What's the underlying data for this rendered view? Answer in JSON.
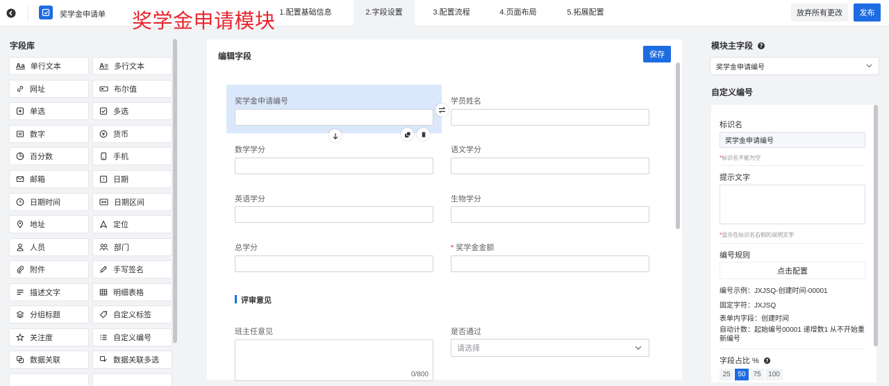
{
  "header": {
    "app_name": "奖学金申请单",
    "overlay_title": "奖学金申请模块",
    "steps": [
      {
        "label": "1.配置基础信息"
      },
      {
        "label": "2.字段设置"
      },
      {
        "label": "3.配置流程"
      },
      {
        "label": "4.页面布局"
      },
      {
        "label": "5.拓展配置"
      }
    ],
    "discard_label": "放弃所有更改",
    "publish_label": "发布"
  },
  "library": {
    "title": "字段库",
    "items": [
      {
        "label": "单行文本",
        "icon": "text-icon"
      },
      {
        "label": "多行文本",
        "icon": "multiline-text-icon"
      },
      {
        "label": "网址",
        "icon": "link-icon"
      },
      {
        "label": "布尔值",
        "icon": "boolean-icon"
      },
      {
        "label": "单选",
        "icon": "radio-icon"
      },
      {
        "label": "多选",
        "icon": "checkbox-icon"
      },
      {
        "label": "数字",
        "icon": "number-icon"
      },
      {
        "label": "货币",
        "icon": "currency-icon"
      },
      {
        "label": "百分数",
        "icon": "percent-icon"
      },
      {
        "label": "手机",
        "icon": "phone-icon"
      },
      {
        "label": "邮箱",
        "icon": "mail-icon"
      },
      {
        "label": "日期",
        "icon": "date-icon"
      },
      {
        "label": "日期时间",
        "icon": "clock-icon"
      },
      {
        "label": "日期区间",
        "icon": "date-range-icon"
      },
      {
        "label": "地址",
        "icon": "location-icon"
      },
      {
        "label": "定位",
        "icon": "navigation-icon"
      },
      {
        "label": "人员",
        "icon": "person-icon"
      },
      {
        "label": "部门",
        "icon": "department-icon"
      },
      {
        "label": "附件",
        "icon": "paperclip-icon"
      },
      {
        "label": "手写签名",
        "icon": "pen-icon"
      },
      {
        "label": "描述文字",
        "icon": "description-icon"
      },
      {
        "label": "明细表格",
        "icon": "table-icon"
      },
      {
        "label": "分组标题",
        "icon": "layers-icon"
      },
      {
        "label": "自定义标签",
        "icon": "tag-icon"
      },
      {
        "label": "关注度",
        "icon": "star-icon"
      },
      {
        "label": "自定义编号",
        "icon": "list-number-icon"
      },
      {
        "label": "数据关联",
        "icon": "data-link-icon"
      },
      {
        "label": "数据关联多选",
        "icon": "data-link-multi-icon"
      }
    ]
  },
  "editor": {
    "title": "编辑字段",
    "save_label": "保存",
    "fields": {
      "f1": {
        "label": "奖学金申请编号"
      },
      "f2": {
        "label": "学员姓名"
      },
      "f3": {
        "label": "数学学分"
      },
      "f4": {
        "label": "语文学分"
      },
      "f5": {
        "label": "英语学分"
      },
      "f6": {
        "label": "生物学分"
      },
      "f7": {
        "label": "总学分"
      },
      "f8": {
        "label": "奖学金金额",
        "required_mark": "*"
      }
    },
    "section_title": "评审意见",
    "comment_label": "班主任意见",
    "comment_counter": "0/800",
    "pass_label": "是否通过",
    "pass_placeholder": "请选择"
  },
  "right": {
    "main_field_title": "模块主字段",
    "main_field_value": "奖学金申请编号",
    "custom_number_title": "自定义编号",
    "id_name_label": "标识名",
    "id_name_value": "奖学金申请编号",
    "id_name_hint_mark": "*",
    "id_name_hint": "标识名不能为空",
    "prompt_label": "提示文字",
    "prompt_hint_mark": "*",
    "prompt_hint": "显示在标识名右侧的说明文字",
    "rule_label": "编号规则",
    "config_label": "点击配置",
    "example": "编号示例：JXJSQ-创建时间-00001",
    "fixed_chars": "固定字符：JXJSQ",
    "form_field": "表单内字段：创建时间",
    "auto_count": "自动计数：起始编号00001 递增数1 从不开始重新编号",
    "ratio_label": "字段占比 %",
    "ratio_options": [
      "25",
      "50",
      "75",
      "100"
    ],
    "ratio_selected": "50"
  },
  "colors": {
    "accent": "#1d6ce1",
    "overlay_title": "#e8262e",
    "selected_field": "#dbe8fb"
  }
}
